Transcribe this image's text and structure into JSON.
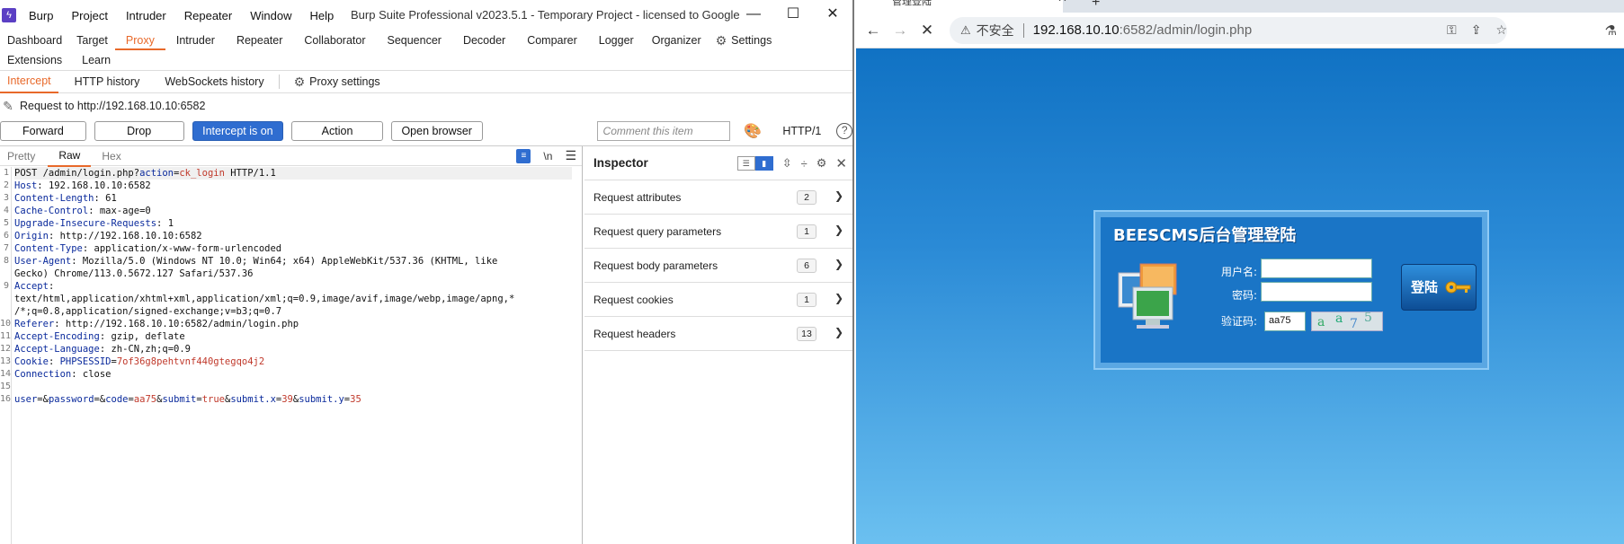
{
  "burp": {
    "menus": [
      "Burp",
      "Project",
      "Intruder",
      "Repeater",
      "Window",
      "Help"
    ],
    "window_title": "Burp Suite Professional v2023.5.1 - Temporary Project - licensed to Google",
    "window_controls": {
      "minimize": "—",
      "maximize": "☐",
      "close": "✕"
    },
    "main_tabs": [
      "Dashboard",
      "Target",
      "Proxy",
      "Intruder",
      "Repeater",
      "Collaborator",
      "Sequencer",
      "Decoder",
      "Comparer",
      "Logger",
      "Organizer"
    ],
    "main_tabs_row2": [
      "Extensions",
      "Learn"
    ],
    "settings_label": "Settings",
    "active_main_tab": "Proxy",
    "proxy_tabs": [
      "Intercept",
      "HTTP history",
      "WebSockets history"
    ],
    "proxy_settings_label": "Proxy settings",
    "request_to": "Request to http://192.168.10.10:6582",
    "buttons": {
      "forward": "Forward",
      "drop": "Drop",
      "intercept": "Intercept is on",
      "action": "Action",
      "open_browser": "Open browser"
    },
    "comment_placeholder": "Comment this item",
    "http_version": "HTTP/1",
    "help": "?",
    "editor_tabs": [
      "Pretty",
      "Raw",
      "Hex"
    ],
    "newline_toggle": "\\n",
    "request": {
      "line_numbers": [
        "1",
        "2",
        "3",
        "4",
        "5",
        "6",
        "7",
        "8",
        "",
        "9",
        "",
        "",
        "10",
        "11",
        "12",
        "13",
        "14",
        "15",
        "16"
      ],
      "request_line": {
        "method_path": "POST /admin/login.php?",
        "param_name": "action",
        "eq": "=",
        "param_value": "ck_login",
        "version": " HTTP/1.1"
      },
      "headers": [
        {
          "name": "Host",
          "value": " 192.168.10.10:6582"
        },
        {
          "name": "Content-Length",
          "value": " 61"
        },
        {
          "name": "Cache-Control",
          "value": " max-age=0"
        },
        {
          "name": "Upgrade-Insecure-Requests",
          "value": " 1"
        },
        {
          "name": "Origin",
          "value": " http://192.168.10.10:6582"
        },
        {
          "name": "Content-Type",
          "value": " application/x-www-form-urlencoded"
        },
        {
          "name": "User-Agent",
          "value": " Mozilla/5.0 (Windows NT 10.0; Win64; x64) AppleWebKit/537.36 (KHTML, like"
        }
      ],
      "ua_cont": "Gecko) Chrome/113.0.5672.127 Safari/537.36",
      "accept_name": "Accept",
      "accept_value_1": "text/html,application/xhtml+xml,application/xml;q=0.9,image/avif,image/webp,image/apng,*",
      "accept_value_2": "/*;q=0.8,application/signed-exchange;v=b3;q=0.7",
      "headers_2": [
        {
          "name": "Referer",
          "value": " http://192.168.10.10:6582/admin/login.php"
        },
        {
          "name": "Accept-Encoding",
          "value": " gzip, deflate"
        },
        {
          "name": "Accept-Language",
          "value": " zh-CN,zh;q=0.9"
        }
      ],
      "cookie": {
        "name": "Cookie",
        "cname": "PHPSESSID",
        "cvalue": "7of36g8pehtvnf440gtegqo4j2"
      },
      "connection": {
        "name": "Connection",
        "value": " close"
      },
      "body": [
        {
          "k": "user",
          "v": ""
        },
        {
          "k": "password",
          "v": ""
        },
        {
          "k": "code",
          "v": "aa75"
        },
        {
          "k": "submit",
          "v": "true"
        },
        {
          "k": "submit.x",
          "v": "39"
        },
        {
          "k": "submit.y",
          "v": "35"
        }
      ]
    },
    "inspector": {
      "title": "Inspector",
      "rows": [
        {
          "label": "Request attributes",
          "count": "2"
        },
        {
          "label": "Request query parameters",
          "count": "1"
        },
        {
          "label": "Request body parameters",
          "count": "6"
        },
        {
          "label": "Request cookies",
          "count": "1"
        },
        {
          "label": "Request headers",
          "count": "13"
        }
      ]
    }
  },
  "browser": {
    "tab_title": "管理登陆",
    "nav": {
      "back": "←",
      "forward": "→",
      "stop": "✕"
    },
    "insecure_label": "不安全",
    "url_host": "192.168.10.10",
    "url_rest": ":6582/admin/login.php",
    "login": {
      "title": "BEESCMS后台管理登陆",
      "username_label": "用户名:",
      "password_label": "密码:",
      "code_label": "验证码:",
      "username_value": "",
      "password_value": "",
      "code_value": "aa75",
      "captcha": [
        "a",
        "a",
        "7",
        "5"
      ],
      "button": "登陆"
    }
  }
}
